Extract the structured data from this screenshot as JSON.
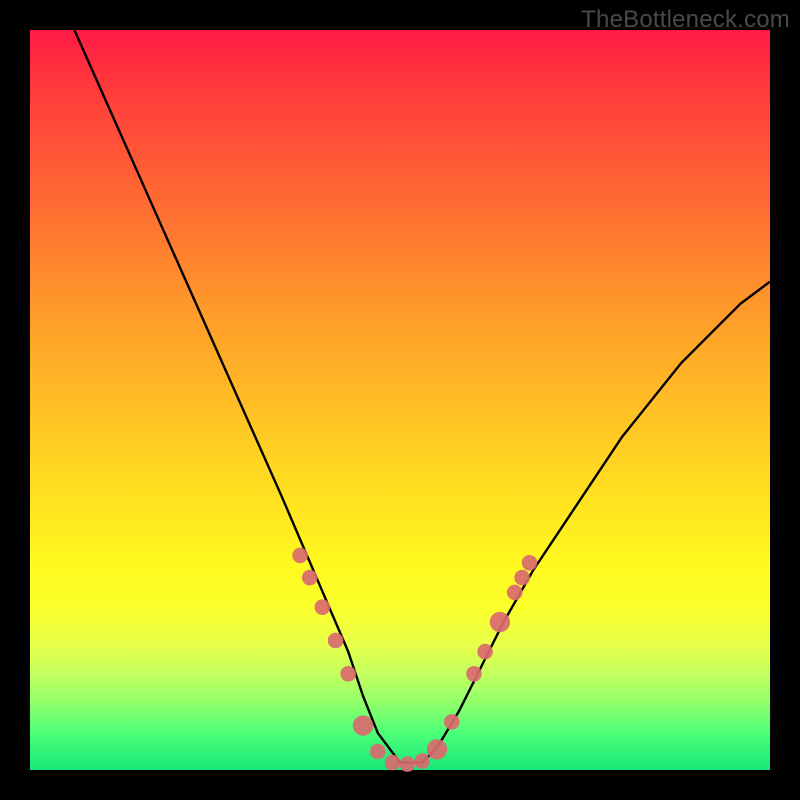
{
  "watermark": "TheBottleneck.com",
  "chart_data": {
    "type": "line",
    "title": "",
    "xlabel": "",
    "ylabel": "",
    "xlim": [
      0,
      100
    ],
    "ylim": [
      0,
      100
    ],
    "series": [
      {
        "name": "curve",
        "x": [
          6,
          10,
          14,
          18,
          22,
          26,
          30,
          34,
          37,
          40,
          43,
          45,
          47,
          50,
          53,
          55,
          58,
          61,
          64,
          68,
          72,
          76,
          80,
          84,
          88,
          92,
          96,
          100
        ],
        "y": [
          100,
          91,
          82,
          73,
          64,
          55,
          46,
          37,
          30,
          23,
          16,
          10,
          5,
          1,
          1,
          3,
          8,
          14,
          20,
          27,
          33,
          39,
          45,
          50,
          55,
          59,
          63,
          66
        ]
      }
    ],
    "markers": [
      {
        "x": 36.5,
        "y": 29,
        "r": 1.3
      },
      {
        "x": 37.8,
        "y": 26,
        "r": 1.3
      },
      {
        "x": 39.5,
        "y": 22,
        "r": 1.3
      },
      {
        "x": 41.3,
        "y": 17.5,
        "r": 1.3
      },
      {
        "x": 43.0,
        "y": 13,
        "r": 1.3
      },
      {
        "x": 45.0,
        "y": 6,
        "r": 1.7
      },
      {
        "x": 47.0,
        "y": 2.5,
        "r": 1.3
      },
      {
        "x": 49.0,
        "y": 1.0,
        "r": 1.3
      },
      {
        "x": 51.0,
        "y": 0.8,
        "r": 1.3
      },
      {
        "x": 53.0,
        "y": 1.2,
        "r": 1.3
      },
      {
        "x": 55.0,
        "y": 2.8,
        "r": 1.7
      },
      {
        "x": 57.0,
        "y": 6.5,
        "r": 1.3
      },
      {
        "x": 60.0,
        "y": 13,
        "r": 1.3
      },
      {
        "x": 61.5,
        "y": 16,
        "r": 1.3
      },
      {
        "x": 63.5,
        "y": 20,
        "r": 1.7
      },
      {
        "x": 65.5,
        "y": 24,
        "r": 1.3
      },
      {
        "x": 66.5,
        "y": 26,
        "r": 1.3
      },
      {
        "x": 67.5,
        "y": 28,
        "r": 1.3
      }
    ],
    "marker_color": "#d96a6f",
    "curve_color": "#000000"
  }
}
